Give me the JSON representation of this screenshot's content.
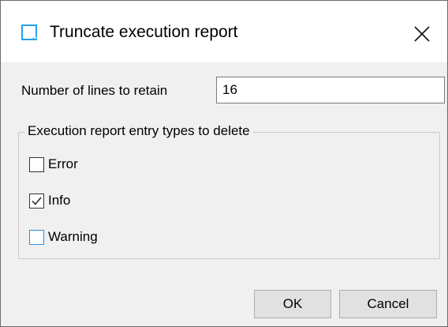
{
  "dialog": {
    "title": "Truncate execution report",
    "icon": "window-app-icon",
    "close_icon": "close-icon"
  },
  "lines_field": {
    "label": "Number of lines to retain",
    "value": "16"
  },
  "entry_types": {
    "legend": "Execution report entry types to delete",
    "options": [
      {
        "label": "Error",
        "checked": false
      },
      {
        "label": "Info",
        "checked": true
      },
      {
        "label": "Warning",
        "checked": false,
        "focused": true
      }
    ]
  },
  "buttons": {
    "ok_label": "OK",
    "cancel_label": "Cancel"
  },
  "colors": {
    "accent": "#2b9ee8",
    "dialog_background": "#f0f0f0",
    "button_background": "#e1e1e1"
  }
}
